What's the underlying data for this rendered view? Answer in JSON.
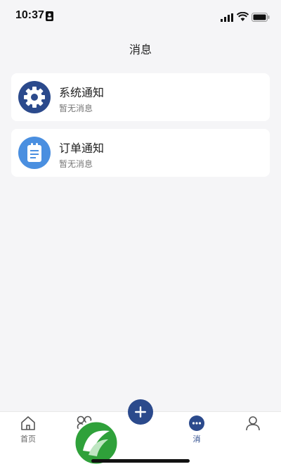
{
  "status_bar": {
    "time": "10:37",
    "icons": [
      "id-card-icon",
      "signal-icon",
      "wifi-icon",
      "battery-icon"
    ]
  },
  "header": {
    "title": "消息"
  },
  "notifications": [
    {
      "title": "系统通知",
      "subtitle": "暂无消息",
      "icon": "gear-icon",
      "color": "#2b4a8c"
    },
    {
      "title": "订单通知",
      "subtitle": "暂无消息",
      "icon": "clipboard-icon",
      "color": "#4a8fe0"
    }
  ],
  "tabbar": {
    "items": [
      {
        "label": "首页",
        "icon": "home-icon"
      },
      {
        "label": "",
        "icon": "discover-icon"
      },
      {
        "label": "",
        "icon": "plus-icon"
      },
      {
        "label": "消",
        "icon": "message-icon",
        "active": true
      },
      {
        "label": "",
        "icon": "user-icon"
      }
    ]
  },
  "colors": {
    "accent": "#2b4a8c",
    "background": "#f5f5f7",
    "watermark": "#2fa13a"
  }
}
